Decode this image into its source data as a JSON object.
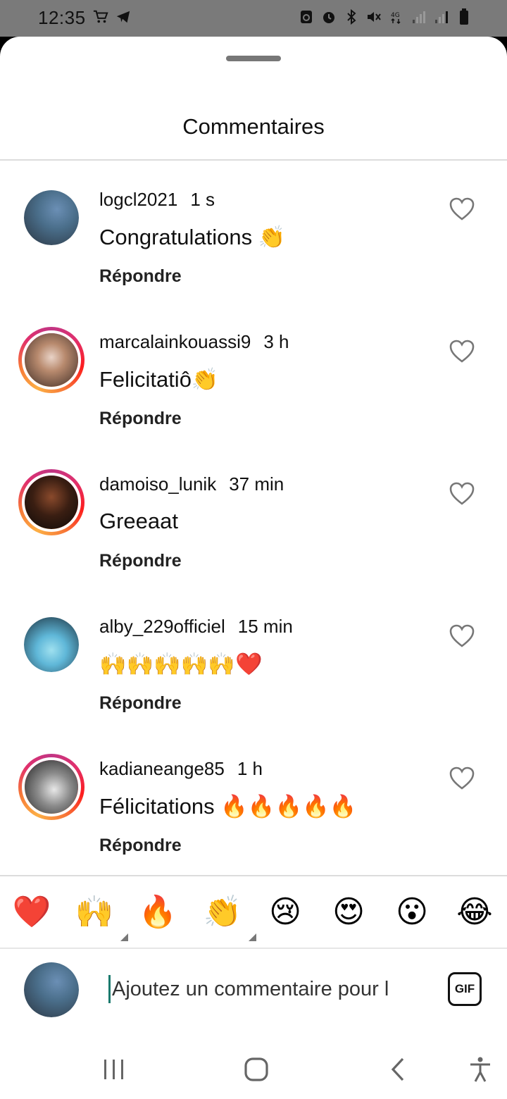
{
  "status_bar": {
    "time": "12:35",
    "left_icons": [
      "cart-icon",
      "telegram-icon"
    ],
    "right_icons": [
      "recycle-icon",
      "alarm-icon",
      "bluetooth-icon",
      "mute-icon",
      "network-4g-icon",
      "signal-icon",
      "signal-icon",
      "battery-icon"
    ]
  },
  "sheet": {
    "title": "Commentaires"
  },
  "comments": [
    {
      "username": "logcl2021",
      "time": "1 s",
      "text": "Congratulations 👏",
      "reply": "Répondre",
      "story_ring": false,
      "avatar_colors": [
        "#6b8fb5",
        "#2a3440"
      ]
    },
    {
      "username": "marcalainkouassi9",
      "time": "3 h",
      "text": "Felicitatiô👏",
      "reply": "Répondre",
      "story_ring": true,
      "avatar_colors": [
        "#e9d3c7",
        "#3b2a23"
      ]
    },
    {
      "username": "damoiso_lunik",
      "time": "37 min",
      "text": "Greeaat",
      "reply": "Répondre",
      "story_ring": true,
      "avatar_colors": [
        "#3a1e12",
        "#0d0a08"
      ]
    },
    {
      "username": "alby_229officiel",
      "time": "15 min",
      "text": "🙌🙌🙌🙌🙌❤️",
      "reply": "Répondre",
      "story_ring": false,
      "avatar_colors": [
        "#5fb7d8",
        "#1a2d3a"
      ]
    },
    {
      "username": "kadianeange85",
      "time": "1 h",
      "text": "Félicitations 🔥🔥🔥🔥🔥",
      "reply": "Répondre",
      "story_ring": true,
      "avatar_colors": [
        "#8a8a8a",
        "#1e1e1e"
      ]
    }
  ],
  "reactions": [
    {
      "emoji": "❤️",
      "name": "heart",
      "has_variants": false
    },
    {
      "emoji": "🙌",
      "name": "raising-hands",
      "has_variants": true
    },
    {
      "emoji": "🔥",
      "name": "fire",
      "has_variants": false
    },
    {
      "emoji": "👏",
      "name": "clapping-hands",
      "has_variants": true
    },
    {
      "emoji": "😢",
      "name": "crying-face",
      "has_variants": false
    },
    {
      "emoji": "😍",
      "name": "heart-eyes",
      "has_variants": false
    },
    {
      "emoji": "😮",
      "name": "open-mouth",
      "has_variants": false
    },
    {
      "emoji": "😂",
      "name": "tears-of-joy",
      "has_variants": false
    }
  ],
  "input": {
    "placeholder": "Ajoutez un commentaire pour l",
    "gif_label": "GIF"
  },
  "nav": {
    "buttons": [
      "recent-apps-icon",
      "home-icon",
      "back-icon",
      "accessibility-icon"
    ]
  },
  "colors": {
    "status_bar_bg": "#7a7a7a",
    "text": "#111111",
    "divider": "#dcdcdc",
    "cursor": "#1b7a6e"
  }
}
